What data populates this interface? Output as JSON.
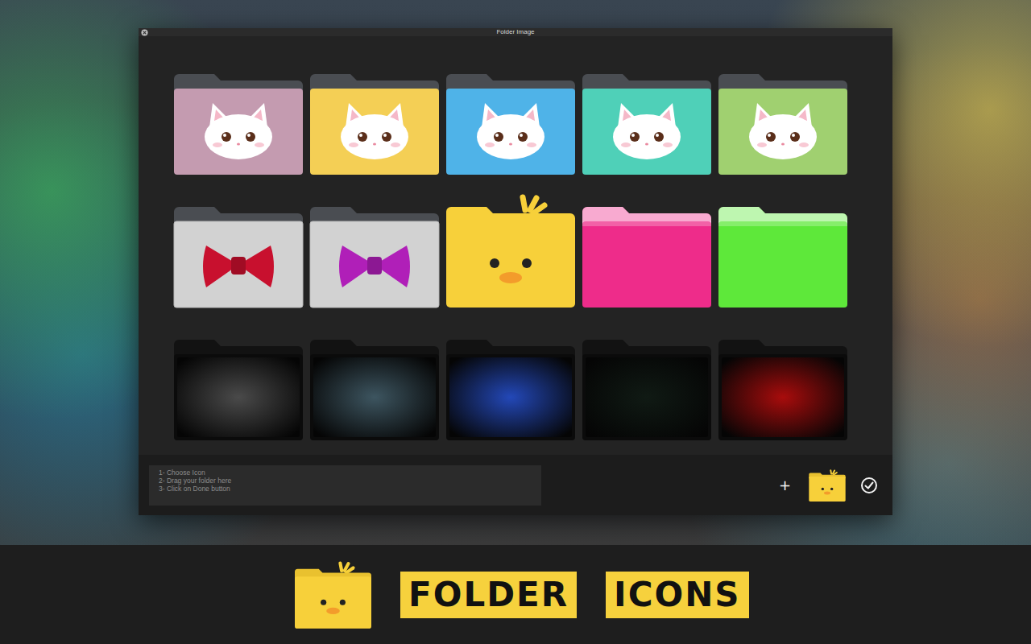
{
  "window": {
    "title": "Folder Image"
  },
  "folders": [
    {
      "kind": "cat",
      "color": "#c49bb0"
    },
    {
      "kind": "cat",
      "color": "#f4cf55"
    },
    {
      "kind": "cat",
      "color": "#4fb3e8"
    },
    {
      "kind": "cat",
      "color": "#4fd0b8"
    },
    {
      "kind": "cat",
      "color": "#a0d070"
    },
    {
      "kind": "bow",
      "color": "#c8102e"
    },
    {
      "kind": "bow",
      "color": "#b01fb8"
    },
    {
      "kind": "duck",
      "color": "#f7d03a"
    },
    {
      "kind": "leather",
      "color": "#ee2c8a"
    },
    {
      "kind": "leather",
      "color": "#5ee83a"
    },
    {
      "kind": "photo",
      "color": "#4a4a4a"
    },
    {
      "kind": "photo",
      "color": "#3d5560"
    },
    {
      "kind": "photo",
      "color": "#2348b8"
    },
    {
      "kind": "photo",
      "color": "#101a14"
    },
    {
      "kind": "photo",
      "color": "#a80c0c"
    }
  ],
  "instructions": [
    "1- Choose Icon",
    "2- Drag your folder here",
    "3- Click on Done button"
  ],
  "add_button": {
    "label": "+"
  },
  "banner": {
    "words": [
      "FOLDER",
      "ICONS"
    ]
  }
}
